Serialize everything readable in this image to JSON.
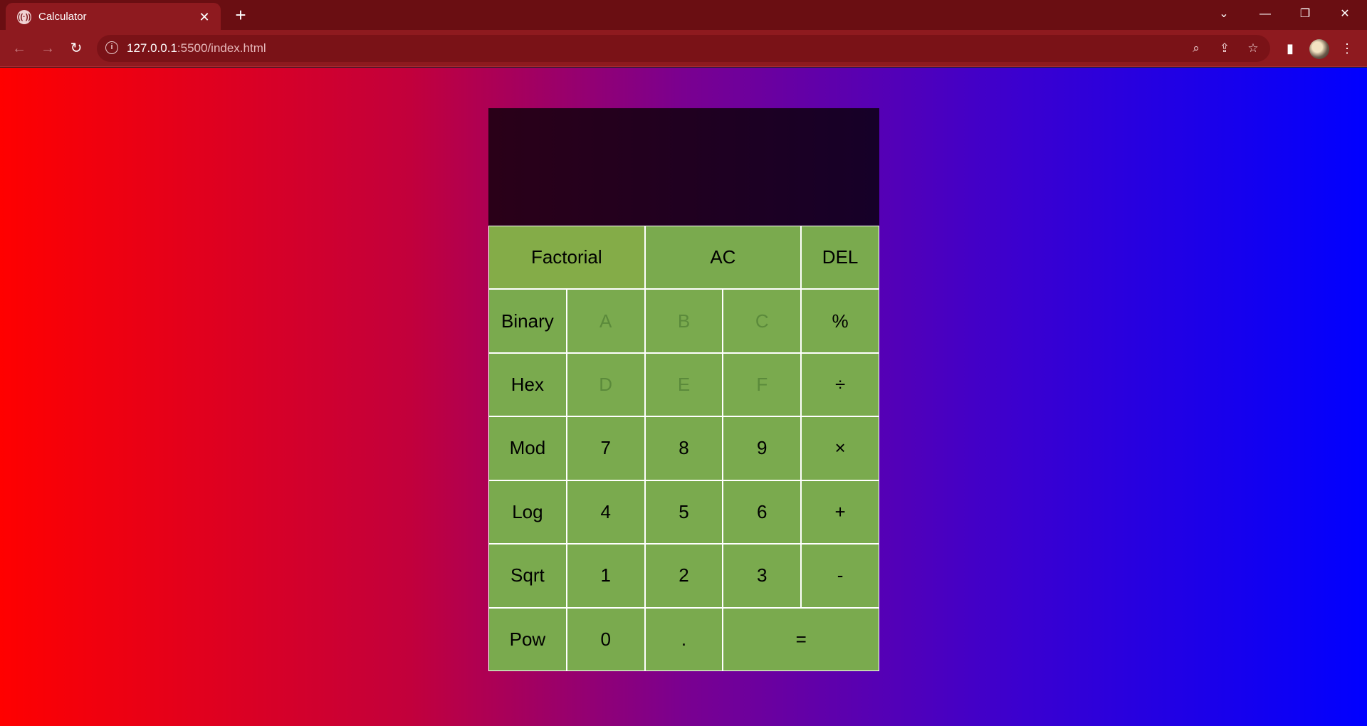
{
  "browser": {
    "tab_title": "Calculator",
    "tab_close": "✕",
    "new_tab": "+",
    "url_host": "127.0.0.1",
    "url_path": ":5500/index.html",
    "window_controls": [
      "⌄",
      "—",
      "❐",
      "✕"
    ]
  },
  "calculator": {
    "display": {
      "previous": "",
      "current": ""
    },
    "rows": [
      [
        "Factorial",
        "AC",
        "DEL"
      ],
      [
        "Binary",
        "A",
        "B",
        "C",
        "%"
      ],
      [
        "Hex",
        "D",
        "E",
        "F",
        "÷"
      ],
      [
        "Mod",
        "7",
        "8",
        "9",
        "×"
      ],
      [
        "Log",
        "4",
        "5",
        "6",
        "+"
      ],
      [
        "Sqrt",
        "1",
        "2",
        "3",
        "-"
      ],
      [
        "Pow",
        "0",
        ".",
        "="
      ]
    ]
  },
  "colors": {
    "key_background": "#7aaa4e",
    "key_border": "#ffffff",
    "disabled_key_text": "#5b8a3b",
    "display_background": "#1f0020",
    "gradient_left": "#ff0000",
    "gradient_right": "#0000ff"
  }
}
